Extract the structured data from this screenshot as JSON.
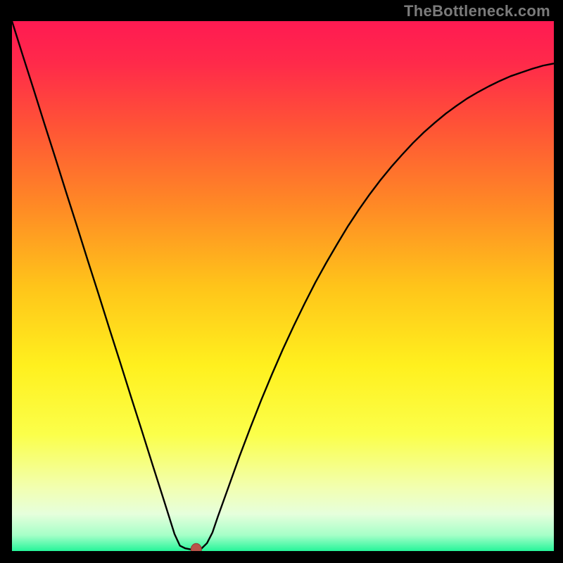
{
  "watermark": "TheBottleneck.com",
  "colors": {
    "frame": "#000000",
    "gradient_stops": [
      {
        "offset": 0.0,
        "color": "#ff1a52"
      },
      {
        "offset": 0.08,
        "color": "#ff2a4a"
      },
      {
        "offset": 0.2,
        "color": "#ff5436"
      },
      {
        "offset": 0.35,
        "color": "#ff8a25"
      },
      {
        "offset": 0.5,
        "color": "#ffc41a"
      },
      {
        "offset": 0.65,
        "color": "#fff01e"
      },
      {
        "offset": 0.78,
        "color": "#fbff4a"
      },
      {
        "offset": 0.88,
        "color": "#f2ffb0"
      },
      {
        "offset": 0.93,
        "color": "#e6ffdc"
      },
      {
        "offset": 0.97,
        "color": "#a6ffc8"
      },
      {
        "offset": 1.0,
        "color": "#26f59a"
      }
    ],
    "curve": "#000000",
    "marker_fill": "#b9534a",
    "marker_stroke": "#8f3e37"
  },
  "chart_data": {
    "type": "line",
    "title": "",
    "xlabel": "",
    "ylabel": "",
    "xlim": [
      0,
      100
    ],
    "ylim": [
      0,
      100
    ],
    "x": [
      0,
      2,
      4,
      6,
      8,
      10,
      12,
      14,
      16,
      18,
      20,
      22,
      24,
      26,
      28,
      30,
      31,
      32,
      33,
      34,
      35,
      36,
      37,
      38,
      40,
      42,
      44,
      46,
      48,
      50,
      52,
      54,
      56,
      58,
      60,
      62,
      64,
      66,
      68,
      70,
      72,
      74,
      76,
      78,
      80,
      82,
      84,
      86,
      88,
      90,
      92,
      94,
      96,
      98,
      100
    ],
    "values": [
      100,
      93.5,
      87.1,
      80.6,
      74.2,
      67.7,
      61.3,
      54.8,
      48.4,
      41.9,
      35.5,
      29.0,
      22.6,
      16.1,
      9.7,
      3.2,
      1.0,
      0.5,
      0.3,
      0.3,
      0.5,
      1.5,
      3.5,
      6.5,
      12.2,
      17.9,
      23.3,
      28.5,
      33.4,
      38.1,
      42.5,
      46.7,
      50.7,
      54.4,
      57.9,
      61.3,
      64.4,
      67.3,
      70.0,
      72.5,
      74.8,
      77.0,
      79.0,
      80.8,
      82.5,
      84.0,
      85.4,
      86.6,
      87.7,
      88.7,
      89.6,
      90.3,
      91.0,
      91.6,
      92.0
    ],
    "marker": {
      "x": 34,
      "y": 0.3
    },
    "note": "Values are percentages of plot height from bottom; x is percentage of plot width."
  }
}
